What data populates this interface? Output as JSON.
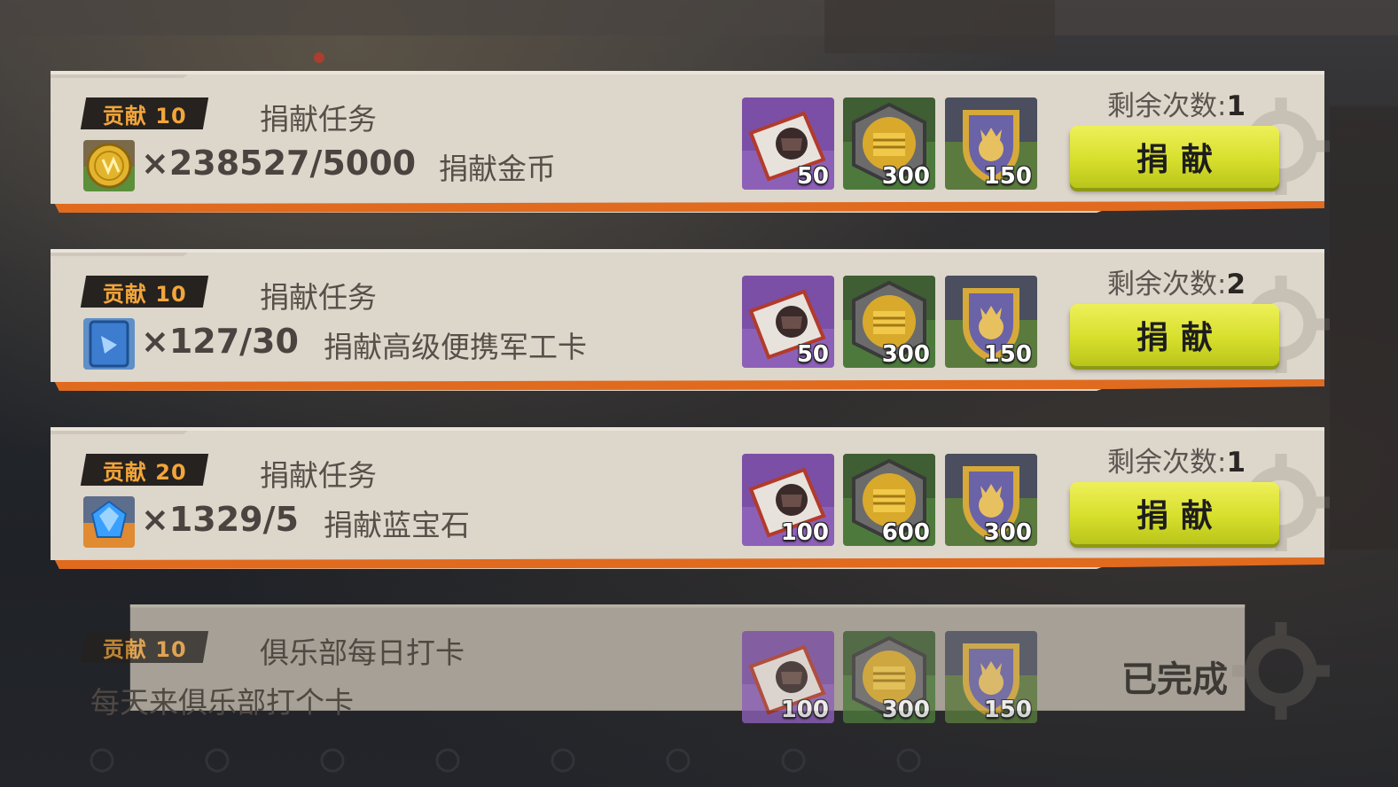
{
  "tasks": [
    {
      "badge": "贡献 10",
      "title": "捐献任务",
      "item_icon": "gold-coin-icon",
      "progress": "×238527/5000",
      "description": "捐献金币",
      "rewards": [
        {
          "icon": "red-ticket-icon",
          "qty": "50"
        },
        {
          "icon": "gold-fist-icon",
          "qty": "300"
        },
        {
          "icon": "club-shield-icon",
          "qty": "150"
        }
      ],
      "remaining": "剩余次数:1",
      "button": "捐献",
      "completed": false
    },
    {
      "badge": "贡献 10",
      "title": "捐献任务",
      "item_icon": "blue-card-icon",
      "progress": "×127/30",
      "description": "捐献高级便携军工卡",
      "rewards": [
        {
          "icon": "red-ticket-icon",
          "qty": "50"
        },
        {
          "icon": "gold-fist-icon",
          "qty": "300"
        },
        {
          "icon": "club-shield-icon",
          "qty": "150"
        }
      ],
      "remaining": "剩余次数:2",
      "button": "捐献",
      "completed": false
    },
    {
      "badge": "贡献 20",
      "title": "捐献任务",
      "item_icon": "sapphire-icon",
      "progress": "×1329/5",
      "description": "捐献蓝宝石",
      "rewards": [
        {
          "icon": "red-ticket-icon",
          "qty": "100"
        },
        {
          "icon": "gold-fist-icon",
          "qty": "600"
        },
        {
          "icon": "club-shield-icon",
          "qty": "300"
        }
      ],
      "remaining": "剩余次数:1",
      "button": "捐献",
      "completed": false
    },
    {
      "badge": "贡献 10",
      "title": "俱乐部每日打卡",
      "description": "每天来俱乐部打个卡",
      "rewards": [
        {
          "icon": "red-ticket-icon",
          "qty": "100"
        },
        {
          "icon": "gold-fist-icon",
          "qty": "300"
        },
        {
          "icon": "club-shield-icon",
          "qty": "150"
        }
      ],
      "status": "已完成",
      "completed": true
    }
  ],
  "colors": {
    "badge_text": "#f3a53a",
    "card_bg": "#ddd6cb",
    "accent_stripe": "#e06a1e",
    "button": "#d7df2c"
  }
}
